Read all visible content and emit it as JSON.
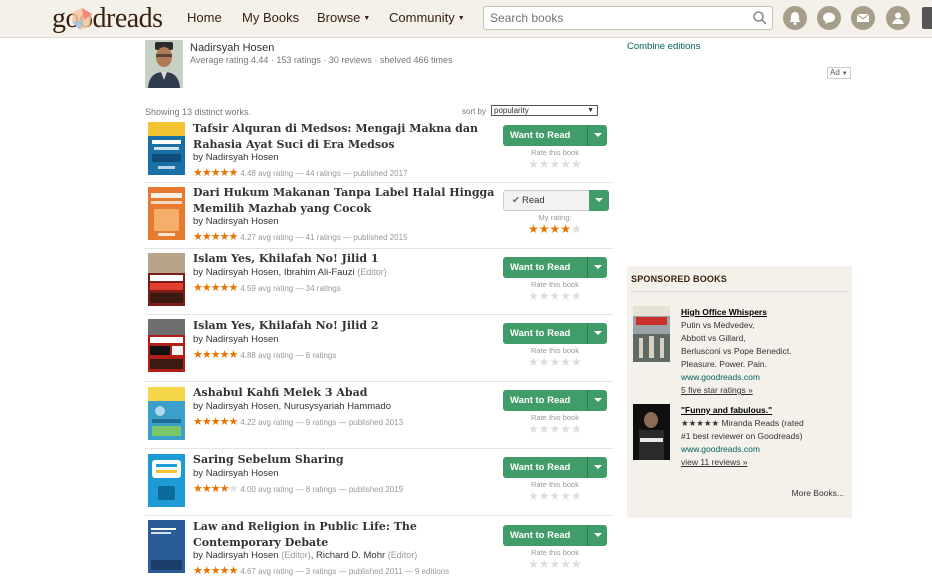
{
  "header": {
    "logo": "goodreads",
    "nav": [
      "Home",
      "My Books",
      "Browse",
      "Community"
    ],
    "search_placeholder": "Search books"
  },
  "author": {
    "name": "Nadirsyah Hosen",
    "stats": "Average rating 4.44 · 153 ratings · 30 reviews · shelved 466 times"
  },
  "combine_label": "Combine editions",
  "ad_label": "Ad",
  "list": {
    "showing": "Showing 13 distinct works.",
    "sort_label": "sort by",
    "sort_value": "popularity"
  },
  "books": [
    {
      "title": "Tafsir Alquran di Medsos: Mengaji Makna dan Rahasia Ayat Suci di Era Medsos",
      "by": "by",
      "authors": "Nadirsyah Hosen",
      "stars": "★★★★★",
      "meta": "4.48 avg rating — 44 ratings — published 2017",
      "button": "Want to Read",
      "rate_label": "Rate this book",
      "cover_color": "#1b6fa7"
    },
    {
      "title": "Dari Hukum Makanan Tanpa Label Halal Hingga Memilih Mazhab yang Cocok",
      "by": "by",
      "authors": "Nadirsyah Hosen",
      "stars": "★★★★★",
      "meta": "4.27 avg rating — 41 ratings — published 2015",
      "button": "Read",
      "rate_label": "My rating:",
      "my_rating": 4,
      "cover_color": "#e67a2e"
    },
    {
      "title": "Islam Yes, Khilafah No! Jilid 1",
      "by": "by",
      "authors": "Nadirsyah Hosen, Ibrahim Ali-Fauzi",
      "role": "(Editor)",
      "stars": "★★★★★",
      "meta": "4.59 avg rating — 34 ratings",
      "button": "Want to Read",
      "rate_label": "Rate this book",
      "cover_color": "#c4302b"
    },
    {
      "title": "Islam Yes, Khilafah No! Jilid 2",
      "by": "by",
      "authors": "Nadirsyah Hosen",
      "stars": "★★★★★",
      "meta": "4.88 avg rating — 8 ratings",
      "button": "Want to Read",
      "rate_label": "Rate this book",
      "cover_color": "#c4302b"
    },
    {
      "title": "Ashabul Kahfi Melek 3 Abad",
      "by": "by",
      "authors": "Nadirsyah Hosen, Nurusysyariah Hammado",
      "stars": "★★★★★",
      "meta": "4.22 avg rating — 9 ratings — published 2013",
      "button": "Want to Read",
      "rate_label": "Rate this book",
      "cover_color": "#3aa0c9"
    },
    {
      "title": "Saring Sebelum Sharing",
      "by": "by",
      "authors": "Nadirsyah Hosen",
      "stars": "★★★★★",
      "meta": "4.00 avg rating — 8 ratings — published 2019",
      "button": "Want to Read",
      "rate_label": "Rate this book",
      "cover_color": "#1e9bd7"
    },
    {
      "title": "Law and Religion in Public Life: The Contemporary Debate",
      "by": "by",
      "authors": "Nadirsyah Hosen",
      "role": "(Editor)",
      "authors2": ", Richard D. Mohr",
      "role2": "(Editor)",
      "stars": "★★★★★",
      "meta": "4.67 avg rating — 3 ratings — published 2011 — 9 editions",
      "button": "Want to Read",
      "rate_label": "Rate this book",
      "cover_color": "#2a5c9a"
    }
  ],
  "empty_stars": "★★★★★",
  "sponsored": {
    "heading": "SPONSORED BOOKS",
    "items": [
      {
        "title": "High Office Whispers",
        "lines": [
          "Putin vs Medvedev,",
          "Abbott vs Gillard,",
          "Berlusconi vs Pope Benedict.",
          "Pleasure. Power. Pain."
        ],
        "url": "www.goodreads.com",
        "link": "5 five star ratings »"
      },
      {
        "title": "\"Funny and fabulous.\"",
        "lines": [
          "★★★★★ Miranda Reads (rated",
          "#1 best reviewer on Goodreads)"
        ],
        "url": "www.goodreads.com",
        "link": "view 11 reviews »"
      }
    ],
    "more": "More Books..."
  }
}
